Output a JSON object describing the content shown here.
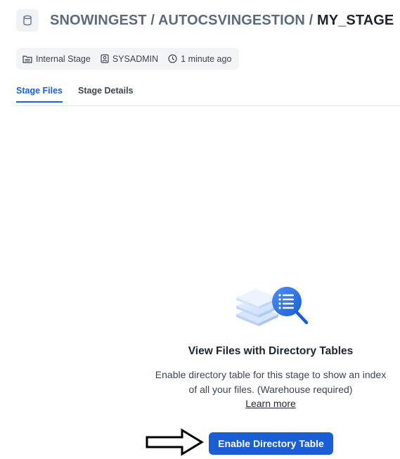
{
  "header": {
    "crumbs": [
      "SNOWINGEST",
      "AUTOCSVINGESTION"
    ],
    "separator": "/",
    "current": "MY_STAGE",
    "icon": "database-icon"
  },
  "meta": {
    "items": [
      {
        "icon": "stage-icon",
        "label": "Internal Stage"
      },
      {
        "icon": "user-role-icon",
        "label": "SYSADMIN"
      },
      {
        "icon": "clock-icon",
        "label": "1 minute ago"
      }
    ]
  },
  "tabs": [
    {
      "label": "Stage Files",
      "active": true
    },
    {
      "label": "Stage Details",
      "active": false
    }
  ],
  "empty_state": {
    "illustration": "directory-search-illustration",
    "title": "View Files with Directory Tables",
    "description": "Enable directory table for this stage to show an index of all your files. (Warehouse required)",
    "link": "Learn more",
    "button": "Enable Directory Table"
  },
  "annotation": {
    "icon": "right-arrow-annotation"
  },
  "colors": {
    "accent": "#1a5ed6",
    "muted": "#5d6a7e",
    "text": "#1e252d"
  }
}
